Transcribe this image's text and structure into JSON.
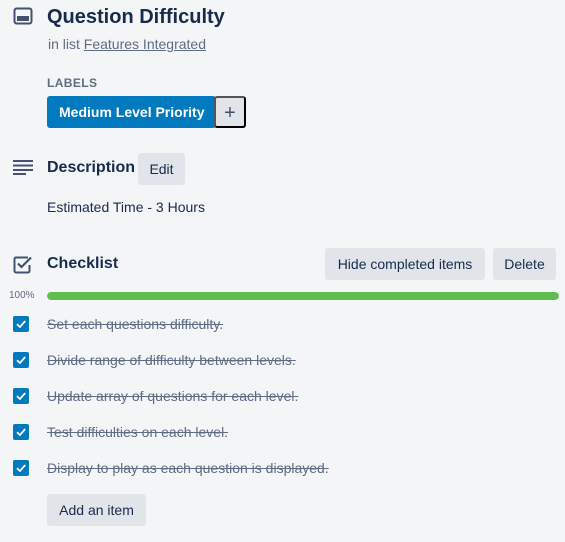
{
  "card": {
    "title": "Question Difficulty",
    "in_list_prefix": "in list",
    "list_name": "Features Integrated"
  },
  "labels": {
    "heading": "LABELS",
    "items": [
      {
        "name": "Medium Level Priority",
        "color": "#0079bf"
      }
    ],
    "add_symbol": "+"
  },
  "description": {
    "heading": "Description",
    "edit_label": "Edit",
    "text": "Estimated Time - 3 Hours"
  },
  "checklist": {
    "heading": "Checklist",
    "hide_completed_label": "Hide completed items",
    "delete_label": "Delete",
    "progress_text": "100%",
    "progress_value": 1.0,
    "progress_color": "#61bd4f",
    "items": [
      {
        "text": "Set each questions difficulty.",
        "checked": true
      },
      {
        "text": "Divide range of difficulty between levels.",
        "checked": true
      },
      {
        "text": "Update array of questions for each level.",
        "checked": true
      },
      {
        "text": "Test difficulties on each level.",
        "checked": true
      },
      {
        "text": "Display to play as each question is displayed.",
        "checked": true
      }
    ],
    "add_item_label": "Add an item"
  },
  "icons": {
    "card": "card-icon",
    "description": "description-lines-icon",
    "checklist": "checklist-checkbox-icon",
    "item_checkbox": "checkmark-icon"
  }
}
